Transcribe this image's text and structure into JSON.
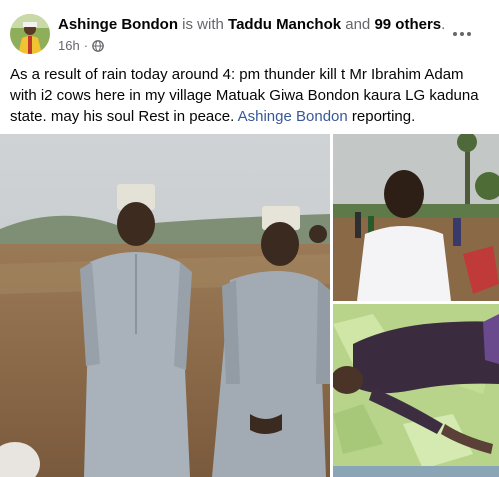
{
  "post": {
    "author": "Ashinge Bondon",
    "with_text": " is with ",
    "tagged": "Taddu Manchok",
    "and_text": " and ",
    "others": "99 others",
    "period": ".",
    "time": "16h",
    "dot": "·",
    "audience_icon": "globe-icon",
    "body": "As a result of rain today around 4: pm thunder kill t Mr Ibrahim Adam with i2 cows here in my village Matuak Giwa Bondon kaura LG kaduna state. may his soul Rest in peace.",
    "mention": "Ashinge Bondon",
    "body_end": " reporting."
  },
  "colors": {
    "link": "#385898",
    "muted": "#65676b",
    "text": "#050505"
  }
}
